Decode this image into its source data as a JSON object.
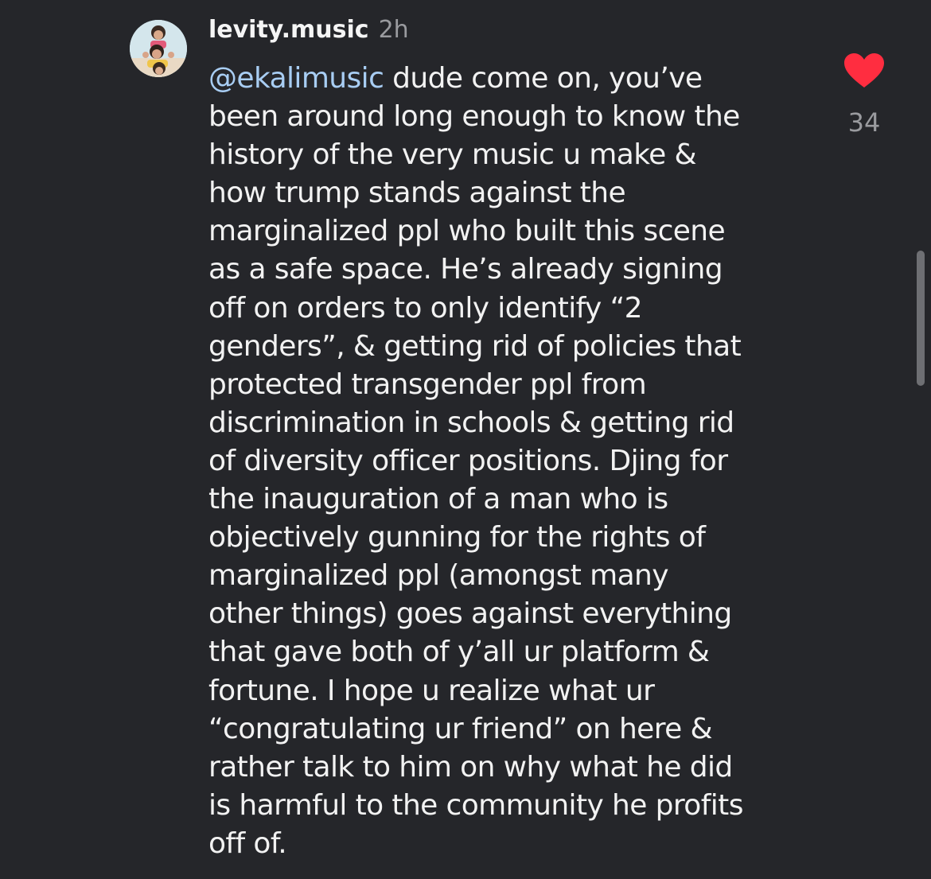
{
  "comment": {
    "username": "levity.music",
    "timestamp": "2h",
    "mention": "@ekalimusic",
    "lines": [
      " dude come on, you’ve",
      "been around long enough to know the",
      "history of the very music u make &",
      "how trump stands against the",
      "marginalized ppl who built this scene",
      "as a safe space. He’s already signing",
      "off on orders to only identify “2",
      "genders”, & getting rid of policies that",
      "protected transgender ppl from",
      "discrimination in schools & getting rid",
      "of diversity officer positions. Djing for",
      "the inauguration of a man who is",
      "objectively gunning for the rights of",
      "marginalized ppl (amongst many",
      "other things) goes against everything",
      "that gave both of y’all ur platform &",
      "fortune. I hope u realize what ur",
      "“congratulating ur friend” on here &",
      "rather talk to him on why what he did",
      "is harmful to the community he profits",
      "off of."
    ],
    "like_icon": "heart-icon",
    "like_count": "34",
    "liked": true
  },
  "colors": {
    "background": "#25262a",
    "text": "#f2f2f2",
    "muted": "#9a9b9f",
    "mention": "#a8cdf3",
    "heart": "#ff2d40"
  }
}
